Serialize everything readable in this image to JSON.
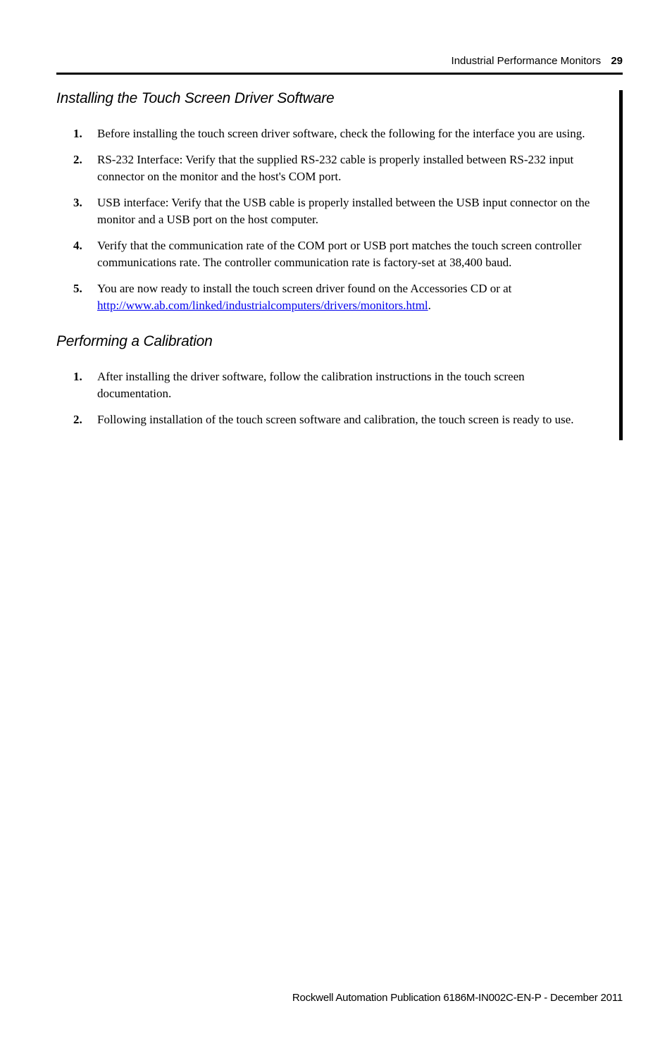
{
  "header": {
    "title": "Industrial Performance Monitors",
    "page_number": "29"
  },
  "sections": [
    {
      "title": "Installing the Touch Screen Driver Software",
      "items": [
        {
          "num": "1.",
          "text": "Before installing the touch screen driver software, check the following for the interface you are using."
        },
        {
          "num": "2.",
          "text": "RS-232 Interface: Verify that the supplied RS-232 cable is properly installed between RS-232 input connector on the monitor and the host's COM port."
        },
        {
          "num": "3.",
          "text": "USB interface: Verify that the USB cable is properly installed between the USB input connector on the monitor and a USB port on the host computer."
        },
        {
          "num": "4.",
          "text": "Verify that the communication rate of the COM port or USB port matches the touch screen controller communications rate. The controller communication rate is factory-set at 38,400 baud."
        },
        {
          "num": "5.",
          "text_before": "You are now ready to install the touch screen driver found on the Accessories CD or at ",
          "link_text": "http://www.ab.com/linked/industrialcomputers/drivers/monitors.html",
          "text_after": "."
        }
      ]
    },
    {
      "title": "Performing a Calibration",
      "items": [
        {
          "num": "1.",
          "text": "After installing the driver software, follow the calibration instructions in the touch screen documentation."
        },
        {
          "num": "2.",
          "text": "Following installation of the touch screen software and calibration, the touch screen is ready to use."
        }
      ]
    }
  ],
  "footer": {
    "text": "Rockwell Automation Publication 6186M-IN002C-EN-P - December 2011"
  }
}
